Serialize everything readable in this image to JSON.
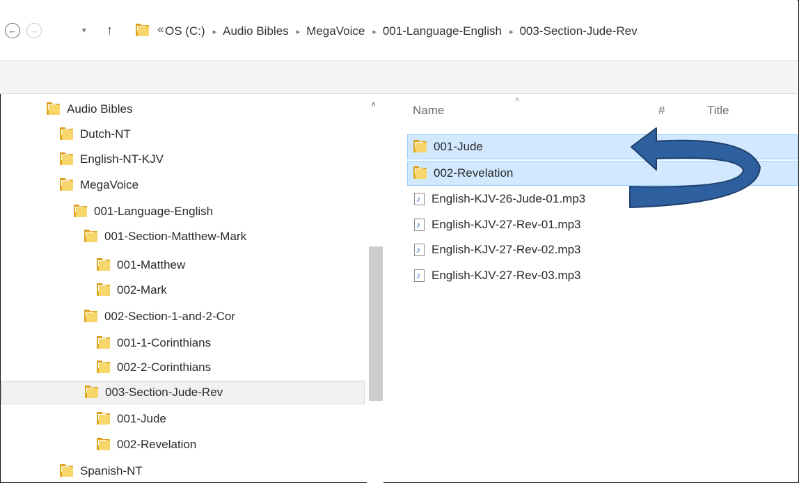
{
  "nav": {
    "back_icon": "back-arrow-icon",
    "forward_icon": "forward-arrow-icon",
    "recent_icon": "chevron-down-icon",
    "up_icon": "up-arrow-icon",
    "back_glyph": "←",
    "forward_glyph": "→",
    "recent_glyph": "▾",
    "up_glyph": "↑",
    "overflow_glyph": "«",
    "separator_glyph": "▸"
  },
  "breadcrumbs": [
    "OS (C:)",
    "Audio Bibles",
    "MegaVoice",
    "001-Language-English",
    "003-Section-Jude-Rev"
  ],
  "tree": {
    "items": [
      {
        "label": "Audio Bibles"
      },
      {
        "label": "Dutch-NT"
      },
      {
        "label": "English-NT-KJV"
      },
      {
        "label": "MegaVoice"
      },
      {
        "label": "001-Language-English"
      },
      {
        "label": "001-Section-Matthew-Mark"
      },
      {
        "label": "001-Matthew"
      },
      {
        "label": "002-Mark"
      },
      {
        "label": "002-Section-1-and-2-Cor"
      },
      {
        "label": "001-1-Corinthians"
      },
      {
        "label": "002-2-Corinthians"
      },
      {
        "label": "003-Section-Jude-Rev",
        "selected": true
      },
      {
        "label": "001-Jude"
      },
      {
        "label": "002-Revelation"
      },
      {
        "label": "Spanish-NT"
      }
    ],
    "scroll_up_glyph": "˄"
  },
  "columns": {
    "name": "Name",
    "number": "#",
    "title": "Title",
    "sort_glyph": "˄"
  },
  "files": [
    {
      "label": "001-Jude",
      "type": "folder",
      "selected": true
    },
    {
      "label": "002-Revelation",
      "type": "folder",
      "selected": true
    },
    {
      "label": "English-KJV-26-Jude-01.mp3",
      "type": "audio"
    },
    {
      "label": "English-KJV-27-Rev-01.mp3",
      "type": "audio"
    },
    {
      "label": "English-KJV-27-Rev-02.mp3",
      "type": "audio"
    },
    {
      "label": "English-KJV-27-Rev-03.mp3",
      "type": "audio"
    }
  ],
  "colors": {
    "selection_fill": "#d1e8ff",
    "selection_border": "#99d1ff",
    "arrow_fill": "#2e5f9e",
    "arrow_stroke": "#1f3f6b",
    "folder": "#f7d66c"
  }
}
